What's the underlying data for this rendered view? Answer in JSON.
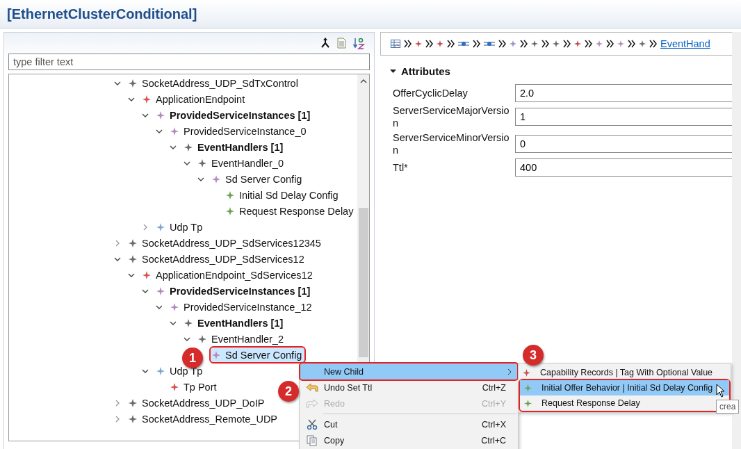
{
  "window": {
    "title": "[EthernetClusterConditional]"
  },
  "outline": {
    "filter": {
      "placeholder": "type filter text"
    },
    "tree": [
      {
        "label": "SocketAddress_UDP_SdTxControl",
        "bold": false,
        "color": "#6b6b6b",
        "expanded": true,
        "selected": false,
        "children": [
          {
            "label": "ApplicationEndpoint",
            "bold": false,
            "color": "#d9534f",
            "expanded": true,
            "selected": false,
            "children": [
              {
                "label": "ProvidedServiceInstances [1]",
                "bold": true,
                "color": "#b58ac0",
                "expanded": true,
                "selected": false,
                "children": [
                  {
                    "label": "ProvidedServiceInstance_0",
                    "bold": false,
                    "color": "#b58ac0",
                    "expanded": true,
                    "selected": false,
                    "children": [
                      {
                        "label": "EventHandlers [1]",
                        "bold": true,
                        "color": "#6b6b6b",
                        "expanded": true,
                        "selected": false,
                        "children": [
                          {
                            "label": "EventHandler_0",
                            "bold": false,
                            "color": "#6b6b6b",
                            "expanded": true,
                            "selected": false,
                            "children": [
                              {
                                "label": "Sd Server Config",
                                "bold": false,
                                "color": "#b58ac0",
                                "expanded": true,
                                "selected": false,
                                "children": [
                                  {
                                    "label": "Initial Sd Delay Config",
                                    "bold": false,
                                    "color": "#6fa050",
                                    "selected": false
                                  },
                                  {
                                    "label": "Request Response Delay",
                                    "bold": false,
                                    "color": "#6fa050",
                                    "selected": false
                                  }
                                ]
                              }
                            ]
                          }
                        ]
                      }
                    ]
                  }
                ]
              },
              {
                "label": "Udp Tp",
                "bold": false,
                "color": "#7fa7cf",
                "expanded": false,
                "selected": false
              }
            ]
          }
        ]
      },
      {
        "label": "SocketAddress_UDP_SdServices12345",
        "bold": false,
        "color": "#6b6b6b",
        "expanded": false,
        "selected": false
      },
      {
        "label": "SocketAddress_UDP_SdServices12",
        "bold": false,
        "color": "#6b6b6b",
        "expanded": true,
        "selected": false,
        "children": [
          {
            "label": "ApplicationEndpoint_SdServices12",
            "bold": false,
            "color": "#d9534f",
            "expanded": true,
            "selected": false,
            "children": [
              {
                "label": "ProvidedServiceInstances [1]",
                "bold": true,
                "color": "#b58ac0",
                "expanded": true,
                "selected": false,
                "children": [
                  {
                    "label": "ProvidedServiceInstance_12",
                    "bold": false,
                    "color": "#b58ac0",
                    "expanded": true,
                    "selected": false,
                    "children": [
                      {
                        "label": "EventHandlers [1]",
                        "bold": true,
                        "color": "#6b6b6b",
                        "expanded": true,
                        "selected": false,
                        "children": [
                          {
                            "label": "EventHandler_2",
                            "bold": false,
                            "color": "#6b6b6b",
                            "expanded": true,
                            "selected": false,
                            "children": [
                              {
                                "label": "Sd Server Config",
                                "bold": false,
                                "color": "#b58ac0",
                                "selected": true,
                                "outlined": true
                              }
                            ]
                          }
                        ]
                      }
                    ]
                  }
                ]
              },
              {
                "label": "Udp Tp",
                "bold": false,
                "color": "#7fa7cf",
                "expanded": true,
                "selected": false,
                "children": [
                  {
                    "label": "Tp Port",
                    "bold": false,
                    "color": "#d9534f",
                    "selected": false
                  }
                ]
              }
            ]
          }
        ]
      },
      {
        "label": "SocketAddress_UDP_DoIP",
        "bold": false,
        "color": "#6b6b6b",
        "expanded": false,
        "selected": false
      },
      {
        "label": "SocketAddress_Remote_UDP",
        "bold": false,
        "color": "#6b6b6b",
        "expanded": false,
        "selected": false
      }
    ]
  },
  "breadcrumb": {
    "items": [
      {
        "kind": "table",
        "color": "#3a6ea5"
      },
      {
        "kind": "diamond",
        "color": "#c0504d"
      },
      {
        "kind": "diamond",
        "color": "#c0504d"
      },
      {
        "kind": "connector",
        "color": "#2a6fc9"
      },
      {
        "kind": "connector",
        "color": "#2a6fc9"
      },
      {
        "kind": "diamond",
        "color": "#9a8fd0"
      },
      {
        "kind": "diamond",
        "color": "#6b6b6b"
      },
      {
        "kind": "diamond",
        "color": "#6b6b6b"
      },
      {
        "kind": "diamond",
        "color": "#c0504d"
      },
      {
        "kind": "diamond",
        "color": "#b58ac0"
      },
      {
        "kind": "diamond",
        "color": "#b58ac0"
      },
      {
        "kind": "diamond",
        "color": "#6b6b6b"
      }
    ],
    "link": "EventHand"
  },
  "attributes": {
    "title": "Attributes",
    "expanded": true,
    "fields": [
      {
        "label": "OfferCyclicDelay",
        "value": "2.0"
      },
      {
        "label": "ServerServiceMajorVersion",
        "value": "1"
      },
      {
        "label": "ServerServiceMinorVersion",
        "value": "0"
      },
      {
        "label": "Ttl*",
        "value": "400"
      }
    ]
  },
  "context_menu": {
    "items": [
      {
        "kind": "submenu",
        "label": "New Child",
        "selected": true,
        "disabled": false,
        "outlined": true
      },
      {
        "kind": "undo",
        "label": "Undo Set Ttl",
        "shortcut": "Ctrl+Z",
        "selected": false,
        "disabled": false,
        "outlined": false
      },
      {
        "kind": "redo",
        "label": "Redo",
        "shortcut": "Ctrl+Y",
        "selected": false,
        "disabled": true,
        "outlined": false
      },
      {
        "kind": "separator"
      },
      {
        "kind": "cut",
        "label": "Cut",
        "shortcut": "Ctrl+X",
        "selected": false,
        "disabled": false,
        "outlined": false
      },
      {
        "kind": "copy",
        "label": "Copy",
        "shortcut": "Ctrl+C",
        "selected": false,
        "disabled": false,
        "outlined": false
      }
    ]
  },
  "submenu": {
    "items": [
      {
        "label": "Capability Records | Tag With Optional Value",
        "color": "#c0504d",
        "selected": false,
        "outlined": false
      },
      {
        "label": "Initial Offer Behavior | Initial Sd Delay Config",
        "color": "#6fa050",
        "selected": true,
        "outlined": true
      },
      {
        "label": "Request Response Delay",
        "color": "#6fa050",
        "selected": false,
        "outlined": true
      }
    ]
  },
  "badges": [
    "1",
    "2",
    "3"
  ],
  "tooltip": {
    "text": "crea"
  }
}
